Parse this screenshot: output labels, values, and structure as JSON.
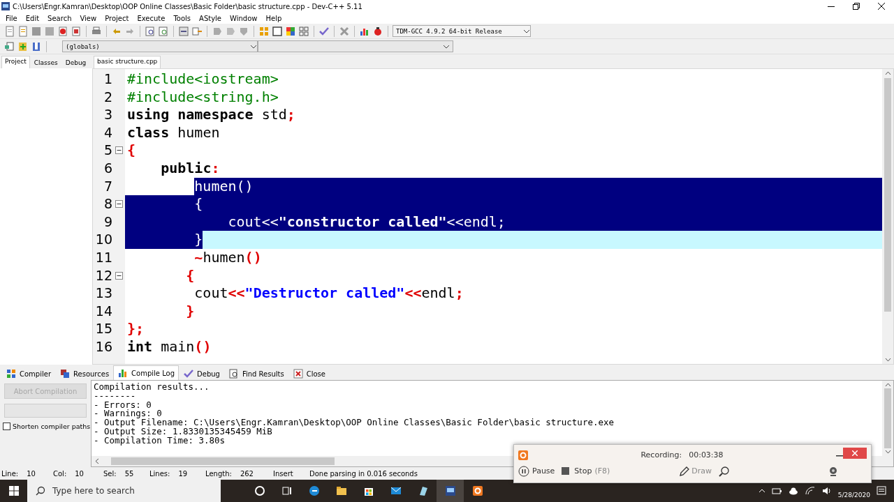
{
  "window": {
    "title": "C:\\Users\\Engr.Kamran\\Desktop\\OOP Online Classes\\Basic Folder\\basic structure.cpp - Dev-C++ 5.11"
  },
  "menu": [
    "File",
    "Edit",
    "Search",
    "View",
    "Project",
    "Execute",
    "Tools",
    "AStyle",
    "Window",
    "Help"
  ],
  "toolbar": {
    "compiler_select": "TDM-GCC 4.9.2 64-bit Release",
    "scope_select": "(globals)"
  },
  "side_tabs": [
    {
      "label": "Project",
      "selected": true
    },
    {
      "label": "Classes",
      "selected": false
    },
    {
      "label": "Debug",
      "selected": false
    }
  ],
  "editor": {
    "tabs": [
      {
        "label": "basic structure.cpp",
        "selected": true
      }
    ],
    "lines": [
      {
        "number": "1",
        "foldable": false,
        "selected": false,
        "current": false,
        "tokens": [
          {
            "text": "#include<iostream>",
            "kind": "preproc"
          }
        ]
      },
      {
        "number": "2",
        "foldable": false,
        "selected": false,
        "current": false,
        "tokens": [
          {
            "text": "#include<string.h>",
            "kind": "preproc"
          }
        ]
      },
      {
        "number": "3",
        "foldable": false,
        "selected": false,
        "current": false,
        "tokens": [
          {
            "text": "using namespace",
            "kind": "keyword"
          },
          {
            "text": " std",
            "kind": "ident"
          },
          {
            "text": ";",
            "kind": "symbol"
          }
        ]
      },
      {
        "number": "4",
        "foldable": false,
        "selected": false,
        "current": false,
        "tokens": [
          {
            "text": "class",
            "kind": "keyword"
          },
          {
            "text": " humen",
            "kind": "ident"
          }
        ]
      },
      {
        "number": "5",
        "foldable": true,
        "selected": false,
        "current": false,
        "tokens": [
          {
            "text": "{",
            "kind": "symbol"
          }
        ]
      },
      {
        "number": "6",
        "foldable": false,
        "selected": false,
        "current": false,
        "tokens": [
          {
            "text": "    public",
            "kind": "keyword"
          },
          {
            "text": ":",
            "kind": "symbol"
          }
        ]
      },
      {
        "number": "7",
        "foldable": false,
        "selected": true,
        "current": false,
        "tokens": [
          {
            "text": "        humen",
            "kind": "ident"
          },
          {
            "text": "()",
            "kind": "symbol"
          }
        ]
      },
      {
        "number": "8",
        "foldable": true,
        "selected": true,
        "current": false,
        "tokens": [
          {
            "text": "        {",
            "kind": "symbol"
          }
        ]
      },
      {
        "number": "9",
        "foldable": false,
        "selected": true,
        "current": false,
        "tokens": [
          {
            "text": "            cout",
            "kind": "ident"
          },
          {
            "text": "<<",
            "kind": "symbol"
          },
          {
            "text": "\"constructor called\"",
            "kind": "string"
          },
          {
            "text": "<<",
            "kind": "symbol"
          },
          {
            "text": "endl",
            "kind": "ident"
          },
          {
            "text": ";",
            "kind": "symbol"
          }
        ]
      },
      {
        "number": "10",
        "foldable": false,
        "selected": true,
        "current": true,
        "tokens": [
          {
            "text": "        }",
            "kind": "symbol"
          }
        ]
      },
      {
        "number": "11",
        "foldable": false,
        "selected": false,
        "current": false,
        "tokens": [
          {
            "text": "        ~",
            "kind": "symbol"
          },
          {
            "text": "humen",
            "kind": "ident"
          },
          {
            "text": "()",
            "kind": "symbol"
          }
        ]
      },
      {
        "number": "12",
        "foldable": true,
        "selected": false,
        "current": false,
        "tokens": [
          {
            "text": "       {",
            "kind": "symbol"
          }
        ]
      },
      {
        "number": "13",
        "foldable": false,
        "selected": false,
        "current": false,
        "tokens": [
          {
            "text": "        cout",
            "kind": "ident"
          },
          {
            "text": "<<",
            "kind": "symbol"
          },
          {
            "text": "\"Destructor called\"",
            "kind": "string"
          },
          {
            "text": "<<",
            "kind": "symbol"
          },
          {
            "text": "endl",
            "kind": "ident"
          },
          {
            "text": ";",
            "kind": "symbol"
          }
        ]
      },
      {
        "number": "14",
        "foldable": false,
        "selected": false,
        "current": false,
        "tokens": [
          {
            "text": "       }",
            "kind": "symbol"
          }
        ]
      },
      {
        "number": "15",
        "foldable": false,
        "selected": false,
        "current": false,
        "tokens": [
          {
            "text": "};",
            "kind": "symbol"
          }
        ]
      },
      {
        "number": "16",
        "foldable": false,
        "selected": false,
        "current": false,
        "tokens": [
          {
            "text": "int",
            "kind": "keyword"
          },
          {
            "text": " main",
            "kind": "ident"
          },
          {
            "text": "()",
            "kind": "symbol"
          }
        ]
      }
    ]
  },
  "bottom_tabs": [
    {
      "label": "Compiler",
      "selected": false
    },
    {
      "label": "Resources",
      "selected": false
    },
    {
      "label": "Compile Log",
      "selected": true
    },
    {
      "label": "Debug",
      "selected": false
    },
    {
      "label": "Find Results",
      "selected": false
    },
    {
      "label": "Close",
      "selected": false
    }
  ],
  "compile_panel": {
    "abort_button": {
      "label": "Abort Compilation",
      "disabled": true
    },
    "progress": {
      "level": 0
    },
    "shorten_paths": {
      "label": "Shorten compiler paths",
      "checked": false
    },
    "log": [
      "Compilation results...",
      "--------",
      "- Errors: 0",
      "- Warnings: 0",
      "- Output Filename: C:\\Users\\Engr.Kamran\\Desktop\\OOP Online Classes\\Basic Folder\\basic structure.exe",
      "- Output Size: 1.8330135345459 MiB",
      "- Compilation Time: 3.80s"
    ]
  },
  "status_bar": [
    {
      "label": "Line:",
      "value": "10"
    },
    {
      "label": "Col:",
      "value": "10"
    },
    {
      "label": "Sel:",
      "value": "55"
    },
    {
      "label": "Lines:",
      "value": "19"
    },
    {
      "label": "Length:",
      "value": "262"
    },
    {
      "value": "Insert"
    },
    {
      "value": "Done parsing in 0.016 seconds"
    }
  ],
  "recorder": {
    "status_label": "Recording:",
    "timer": "00:03:38",
    "pause": "Pause",
    "stop": "Stop",
    "stop_shortcut": "(F8)",
    "draw": "Draw"
  },
  "taskbar": {
    "search_placeholder": "Type here to search",
    "date": "5/28/2020"
  }
}
